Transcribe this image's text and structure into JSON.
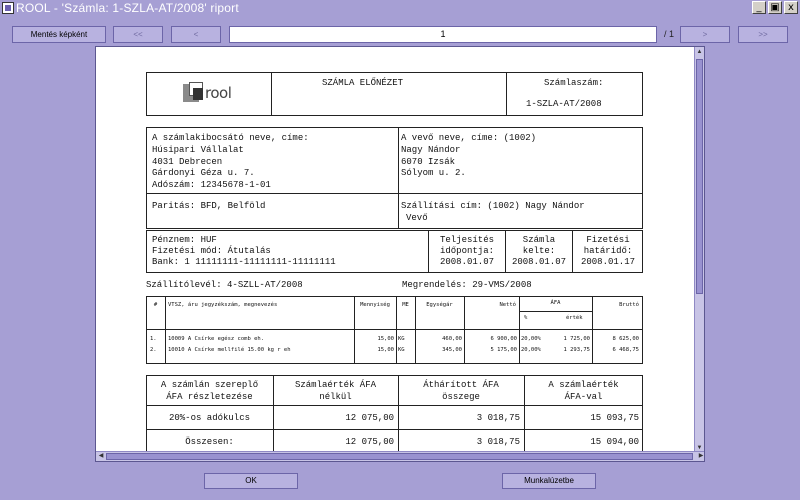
{
  "window": {
    "title": "ROOL  - 'Számla: 1-SZLA-AT/2008' riport",
    "controls": {
      "minimize": "_",
      "maximize": "▣",
      "close": "x"
    }
  },
  "toolbar": {
    "save_image_label": "Mentés képként",
    "first_label": "<<",
    "prev_label": "<",
    "page_value": "1",
    "page_total": "/ 1",
    "next_label": ">",
    "last_label": ">>"
  },
  "invoice": {
    "logo_text": "rool",
    "preview_title": "SZÁMLA ELŐNÉZET",
    "number_label": "Számlaszám:",
    "number_value": "1-SZLA-AT/2008",
    "issuer": {
      "label": "A számlakibocsátó neve, címe:",
      "name": "Húsipari Vállalat",
      "city": "4031 Debrecen",
      "street": "Gárdonyi Géza u. 7.",
      "tax": "Adószám: 12345678-1-01"
    },
    "buyer": {
      "label": "A vevő neve, címe: (1002)",
      "name": "Nagy Nándor",
      "city": "6070 Izsák",
      "street": "Sólyom u. 2."
    },
    "parity": "Paritás: BFD, Belföld",
    "shipping_line1": "Szállítási cím: (1002) Nagy Nándor",
    "shipping_line2": "Vevő",
    "currency": "Pénznem: HUF",
    "payment_mode": "Fizetési mód: Átutalás",
    "bank": "Bank: 1  11111111-11111111-11111111",
    "fulfil_label1": "Teljesítés",
    "fulfil_label2": "időpontja:",
    "fulfil_date": "2008.01.07",
    "issue_label1": "Számla",
    "issue_label2": "kelte:",
    "issue_date": "2008.01.07",
    "due_label1": "Fizetési",
    "due_label2": "határidő:",
    "due_date": "2008.01.17",
    "delivery_note": "Szállítólevél: 4-SZLL-AT/2008",
    "order": "Megrendelés: 29-VMS/2008"
  },
  "items_table": {
    "headers": {
      "no": "#",
      "desc": "VTSZ, áru jegyzékszám, megnevezés",
      "qty": "Mennyiség",
      "unit": "ME",
      "unit_price": "Egységár",
      "net": "Nettó",
      "vat": "ÁFA",
      "vat_pct": "%",
      "vat_val": "érték",
      "gross": "Bruttó"
    },
    "rows": [
      {
        "no": "1.",
        "desc": "10009 A Csírke egész comb eh.",
        "qty": "15,00",
        "unit": "KG",
        "unit_price": "460,00",
        "net": "6 900,00",
        "vat_pct": "20,00%",
        "vat_val": "1 725,00",
        "gross": "8 625,00"
      },
      {
        "no": "2.",
        "desc": "10010 A  Csírke mellfilé 15.00 kg r eh",
        "qty": "15,00",
        "unit": "KG",
        "unit_price": "345,00",
        "net": "5 175,00",
        "vat_pct": "20,00%",
        "vat_val": "1 293,75",
        "gross": "6 468,75"
      }
    ]
  },
  "vat_summary": {
    "headers": {
      "col1a": "A számlán szereplő",
      "col1b": "ÁFA részletezése",
      "col2a": "Számlaérték ÁFA",
      "col2b": "nélkül",
      "col3a": "Áthárított ÁFA",
      "col3b": "összege",
      "col4a": "A számlaérték",
      "col4b": "ÁFA-val"
    },
    "rows": [
      {
        "label": "20%-os adókulcs",
        "net": "12 075,00",
        "vat": "3 018,75",
        "gross": "15 093,75"
      },
      {
        "label": "Összesen:",
        "net": "12 075,00",
        "vat": "3 018,75",
        "gross": "15 094,00"
      }
    ]
  },
  "footer": {
    "ok_label": "OK",
    "workorder_label": "Munkalúzetbe"
  }
}
